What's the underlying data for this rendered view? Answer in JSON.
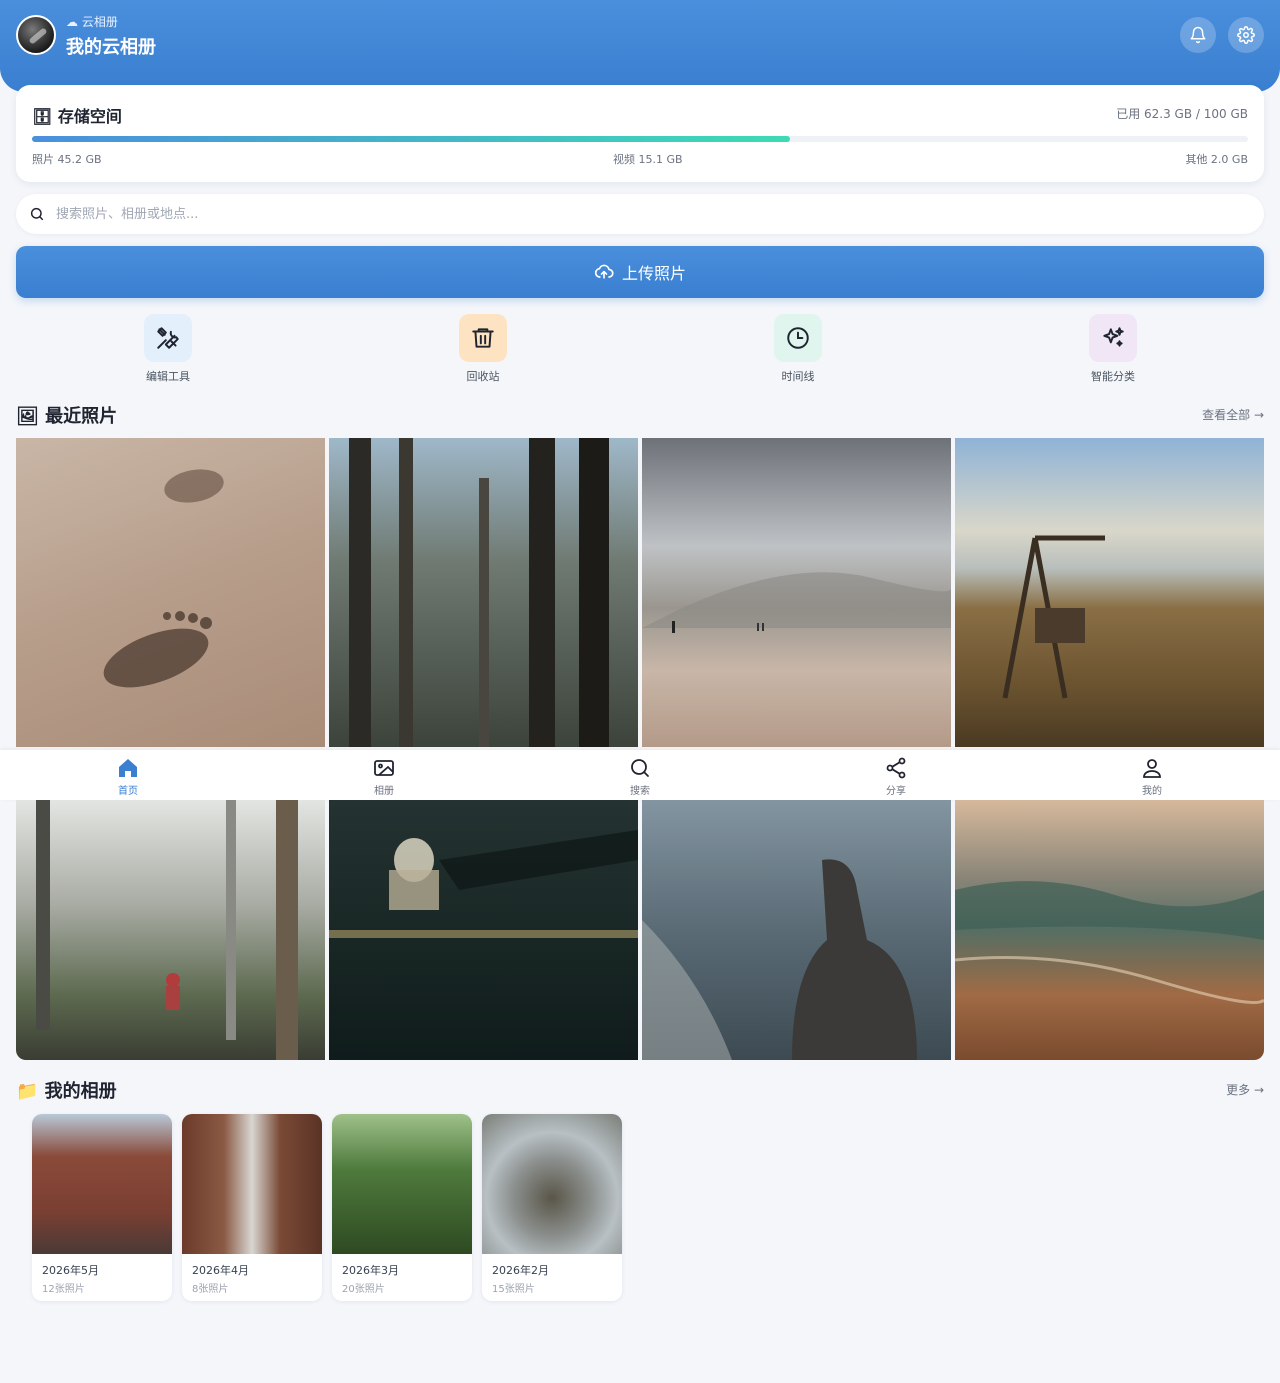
{
  "header": {
    "subtitle": "☁ 云相册",
    "title": "我的云相册",
    "notification_icon": "bell-icon",
    "settings_icon": "gear-icon"
  },
  "storage": {
    "title": "🗄 存储空间",
    "used_text": "已用 62.3 GB / 100 GB",
    "used_fraction": 0.623,
    "breakdown": [
      {
        "label": "照片 45.2 GB"
      },
      {
        "label": "视频 15.1 GB"
      },
      {
        "label": "其他 2.0 GB"
      }
    ],
    "colors": {
      "start": "#4a8fdc",
      "end": "#3ddbb4"
    }
  },
  "search": {
    "placeholder": "搜索照片、相册或地点..."
  },
  "upload": {
    "label": "上传照片",
    "icon": "cloud-upload-icon"
  },
  "quick_actions": [
    {
      "label": "编辑工具",
      "icon": "tools-icon",
      "bg": "#e3f0fb"
    },
    {
      "label": "回收站",
      "icon": "trash-icon",
      "bg": "#fde3c2"
    },
    {
      "label": "时间线",
      "icon": "clock-icon",
      "bg": "#e1f5ef"
    },
    {
      "label": "智能分类",
      "icon": "sparkles-icon",
      "bg": "#f1e6f5"
    }
  ],
  "recent": {
    "title": "🖼 最近照片",
    "link": "查看全部 →",
    "photos": [
      {
        "name": "footprints-sand"
      },
      {
        "name": "tall-forest"
      },
      {
        "name": "beach-walkers"
      },
      {
        "name": "lakeside-swing"
      },
      {
        "name": "misty-forest-hiker"
      },
      {
        "name": "night-bridge-dome"
      },
      {
        "name": "hooded-figure-sea"
      },
      {
        "name": "sunset-waves"
      }
    ]
  },
  "albums": {
    "title": "📁 我的相册",
    "link": "更多 →",
    "items": [
      {
        "name": "2026年5月",
        "count": "12张照片"
      },
      {
        "name": "2026年4月",
        "count": "8张照片"
      },
      {
        "name": "2026年3月",
        "count": "20张照片"
      },
      {
        "name": "2026年2月",
        "count": "15张照片"
      }
    ]
  },
  "bottom_nav": [
    {
      "label": "首页",
      "icon": "home-icon",
      "active": true
    },
    {
      "label": "相册",
      "icon": "image-icon",
      "active": false
    },
    {
      "label": "搜索",
      "icon": "search-icon",
      "active": false
    },
    {
      "label": "分享",
      "icon": "share-icon",
      "active": false
    },
    {
      "label": "我的",
      "icon": "user-icon",
      "active": false
    }
  ],
  "colors": {
    "accent": "#3a7fd0",
    "background": "#f4f6fa"
  }
}
